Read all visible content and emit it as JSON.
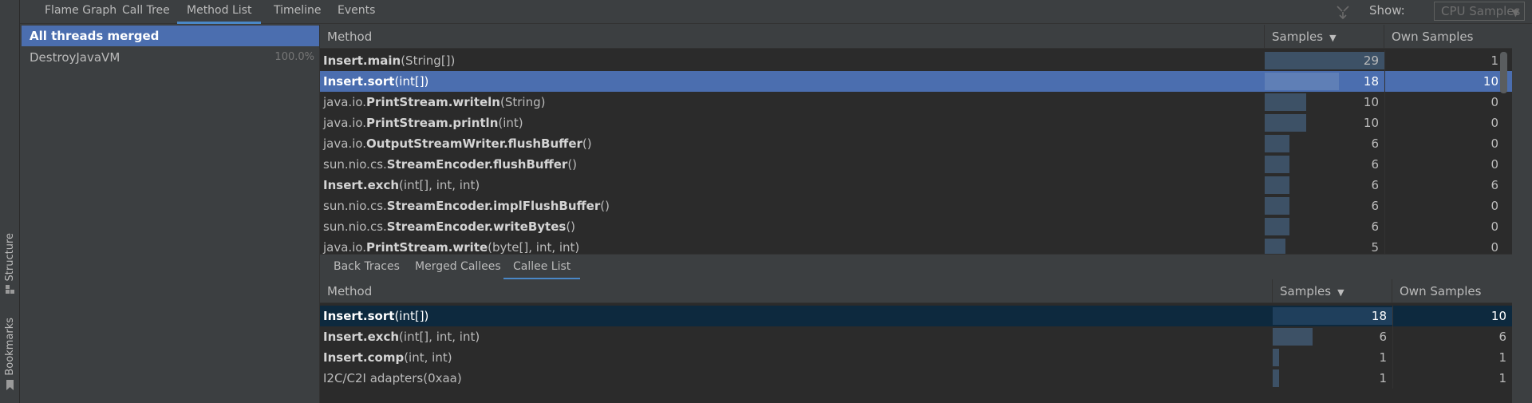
{
  "left_strip": {
    "structure_label": "Structure",
    "bookmarks_label": "Bookmarks"
  },
  "top_tabs": [
    {
      "label": "Flame Graph"
    },
    {
      "label": "Call Tree"
    },
    {
      "label": "Method List"
    },
    {
      "label": "Timeline"
    },
    {
      "label": "Events"
    }
  ],
  "active_top_tab": "Method List",
  "show": {
    "label": "Show:",
    "value": "CPU Samples"
  },
  "threads": [
    {
      "name": "All threads merged",
      "percent": "",
      "selected": true
    },
    {
      "name": "DestroyJavaVM",
      "percent": "100.0%",
      "selected": false
    }
  ],
  "method_table": {
    "headers": {
      "method": "Method",
      "samples": "Samples",
      "own": "Own Samples"
    },
    "max_samples": 29,
    "rows": [
      {
        "prefix": "",
        "bold": "Insert.main",
        "suffix": "(String[])",
        "samples": 29,
        "own": 1,
        "selected": false
      },
      {
        "prefix": "",
        "bold": "Insert.sort",
        "suffix": "(int[])",
        "samples": 18,
        "own": 10,
        "selected": true
      },
      {
        "prefix": "java.io.",
        "bold": "PrintStream.writeln",
        "suffix": "(String)",
        "samples": 10,
        "own": 0,
        "selected": false
      },
      {
        "prefix": "java.io.",
        "bold": "PrintStream.println",
        "suffix": "(int)",
        "samples": 10,
        "own": 0,
        "selected": false
      },
      {
        "prefix": "java.io.",
        "bold": "OutputStreamWriter.flushBuffer",
        "suffix": "()",
        "samples": 6,
        "own": 0,
        "selected": false
      },
      {
        "prefix": "sun.nio.cs.",
        "bold": "StreamEncoder.flushBuffer",
        "suffix": "()",
        "samples": 6,
        "own": 0,
        "selected": false
      },
      {
        "prefix": "",
        "bold": "Insert.exch",
        "suffix": "(int[], int, int)",
        "samples": 6,
        "own": 6,
        "selected": false
      },
      {
        "prefix": "sun.nio.cs.",
        "bold": "StreamEncoder.implFlushBuffer",
        "suffix": "()",
        "samples": 6,
        "own": 0,
        "selected": false
      },
      {
        "prefix": "sun.nio.cs.",
        "bold": "StreamEncoder.writeBytes",
        "suffix": "()",
        "samples": 6,
        "own": 0,
        "selected": false
      },
      {
        "prefix": "java.io.",
        "bold": "PrintStream.write",
        "suffix": "(byte[], int, int)",
        "samples": 5,
        "own": 0,
        "selected": false
      }
    ]
  },
  "sub_tabs": [
    {
      "label": "Back Traces"
    },
    {
      "label": "Merged Callees"
    },
    {
      "label": "Callee List"
    }
  ],
  "active_sub_tab": "Callee List",
  "callee_table": {
    "headers": {
      "method": "Method",
      "samples": "Samples",
      "own": "Own Samples"
    },
    "max_samples": 18,
    "rows": [
      {
        "prefix": "",
        "bold": "Insert.sort",
        "suffix": "(int[])",
        "samples": 18,
        "own": 10,
        "selected": true
      },
      {
        "prefix": "",
        "bold": "Insert.exch",
        "suffix": "(int[], int, int)",
        "samples": 6,
        "own": 6,
        "selected": false
      },
      {
        "prefix": "",
        "bold": "Insert.comp",
        "suffix": "(int, int)",
        "samples": 1,
        "own": 1,
        "selected": false
      },
      {
        "prefix": "",
        "bold": "",
        "suffix": "I2C/C2I adapters(0xaa)",
        "samples": 1,
        "own": 1,
        "selected": false
      }
    ]
  },
  "colors": {
    "background": "#3c3f41",
    "table_background": "#2b2b2b",
    "selection": "#4b6eaf",
    "selection_inactive": "#0d293e",
    "bar": "#3d5166",
    "tab_underline": "#4a88c7"
  }
}
